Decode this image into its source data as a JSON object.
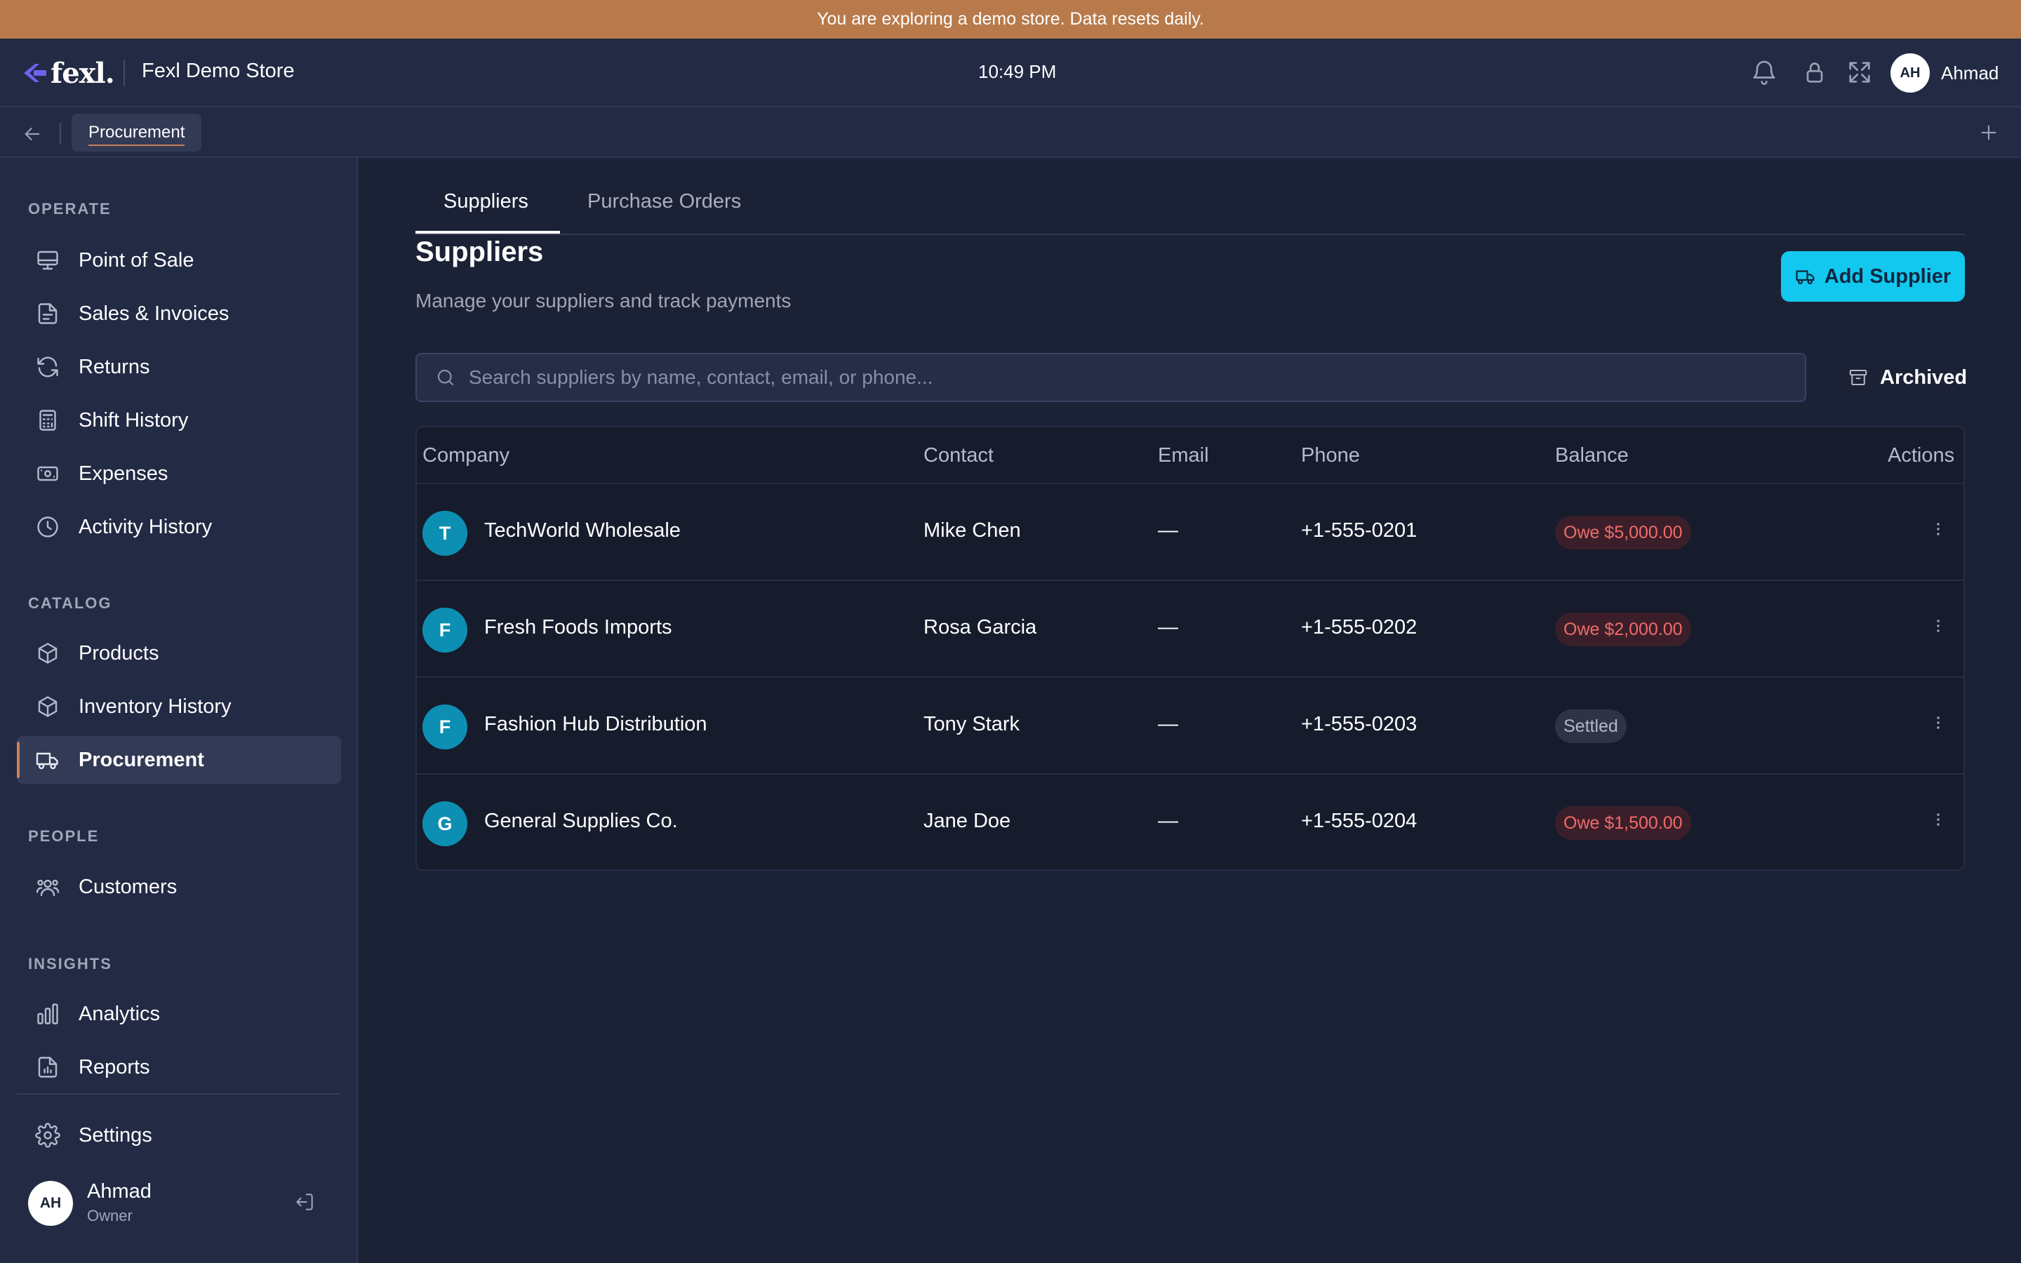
{
  "banner": {
    "text": "You are exploring a demo store. Data resets daily."
  },
  "header": {
    "logo_text": "fexl.",
    "store_name": "Fexl Demo Store",
    "time": "10:49 PM",
    "user_initials": "AH",
    "user_name": "Ahmad"
  },
  "tabbar": {
    "active_tab": "Procurement"
  },
  "sidebar": {
    "sections": {
      "operate": "OPERATE",
      "catalog": "CATALOG",
      "people": "PEOPLE",
      "insights": "INSIGHTS"
    },
    "items": {
      "point_of_sale": "Point of Sale",
      "sales_invoices": "Sales & Invoices",
      "returns": "Returns",
      "shift_history": "Shift History",
      "expenses": "Expenses",
      "activity_history": "Activity History",
      "products": "Products",
      "inventory_history": "Inventory History",
      "procurement": "Procurement",
      "customers": "Customers",
      "analytics": "Analytics",
      "reports": "Reports",
      "settings": "Settings"
    },
    "user": {
      "initials": "AH",
      "name": "Ahmad",
      "role": "Owner"
    }
  },
  "content": {
    "tabs": {
      "suppliers": "Suppliers",
      "purchase_orders": "Purchase Orders"
    },
    "title": "Suppliers",
    "subtitle": "Manage your suppliers and track payments",
    "add_button": "Add Supplier",
    "search_placeholder": "Search suppliers by name, contact, email, or phone...",
    "archived_button": "Archived",
    "table": {
      "headers": {
        "company": "Company",
        "contact": "Contact",
        "email": "Email",
        "phone": "Phone",
        "balance": "Balance",
        "actions": "Actions"
      },
      "rows": [
        {
          "initial": "T",
          "company": "TechWorld Wholesale",
          "contact": "Mike Chen",
          "email": "—",
          "phone": "+1-555-0201",
          "balance": "Owe $5,000.00",
          "status": "owe"
        },
        {
          "initial": "F",
          "company": "Fresh Foods Imports",
          "contact": "Rosa Garcia",
          "email": "—",
          "phone": "+1-555-0202",
          "balance": "Owe $2,000.00",
          "status": "owe"
        },
        {
          "initial": "F",
          "company": "Fashion Hub Distribution",
          "contact": "Tony Stark",
          "email": "—",
          "phone": "+1-555-0203",
          "balance": "Settled",
          "status": "settled"
        },
        {
          "initial": "G",
          "company": "General Supplies Co.",
          "contact": "Jane Doe",
          "email": "—",
          "phone": "+1-555-0204",
          "balance": "Owe $1,500.00",
          "status": "owe"
        }
      ]
    }
  },
  "colors": {
    "banner": "#b87a4b",
    "accent_button": "#13c8ef",
    "owe_text": "#f16a6a",
    "avatar_bg": "#0d8fb3",
    "active_indicator": "#c9805a"
  }
}
